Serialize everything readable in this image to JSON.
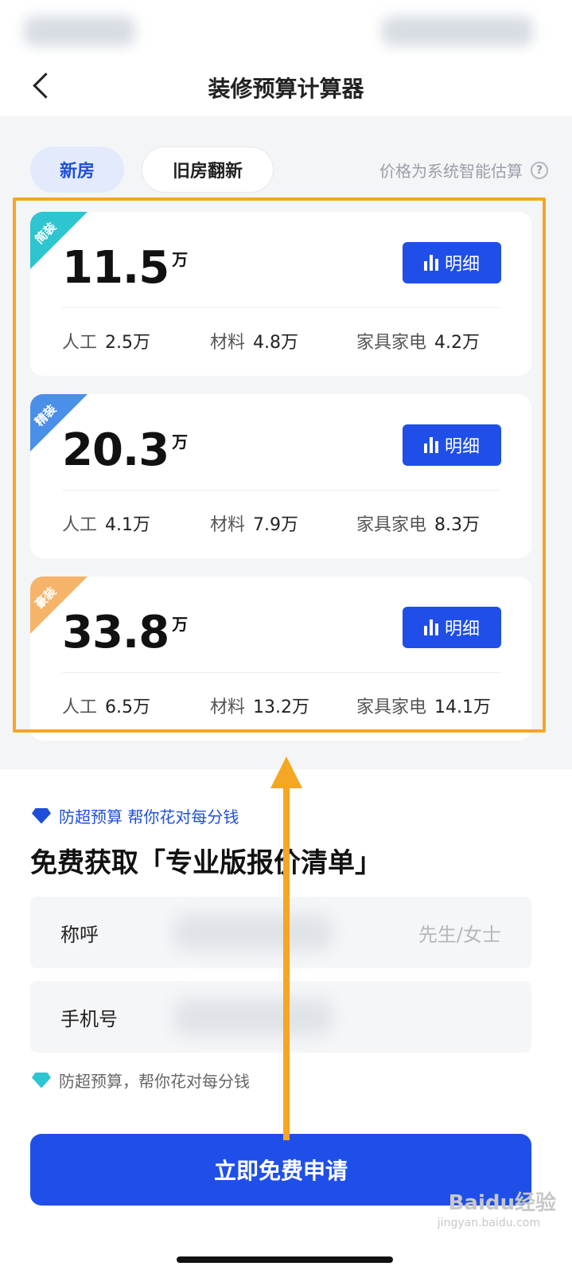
{
  "nav": {
    "title": "装修预算计算器"
  },
  "tabs": [
    {
      "label": "新房"
    },
    {
      "label": "旧房翻新"
    }
  ],
  "price_note": "价格为系统智能估算",
  "help_icon": "question-circle-icon",
  "cards": [
    {
      "tag": "简装",
      "tag_color": "#2cc5d0",
      "total": "11.5",
      "unit": "万",
      "detail_label": "明细",
      "labor_label": "人工",
      "labor": "2.5万",
      "material_label": "材料",
      "material": "4.8万",
      "furniture_label": "家具家电",
      "furniture": "4.2万"
    },
    {
      "tag": "精装",
      "tag_color": "#4a8fe8",
      "total": "20.3",
      "unit": "万",
      "detail_label": "明细",
      "labor_label": "人工",
      "labor": "4.1万",
      "material_label": "材料",
      "material": "7.9万",
      "furniture_label": "家具家电",
      "furniture": "8.3万"
    },
    {
      "tag": "豪装",
      "tag_color": "#f5b46a",
      "total": "33.8",
      "unit": "万",
      "detail_label": "明细",
      "labor_label": "人工",
      "labor": "6.5万",
      "material_label": "材料",
      "material": "13.2万",
      "furniture_label": "家具家电",
      "furniture": "14.1万"
    }
  ],
  "form": {
    "promo_top": "防超预算 帮你花对每分钱",
    "heading": "免费获取「专业版报价清单」",
    "name_label": "称呼",
    "name_placeholder": "先生/女士",
    "phone_label": "手机号",
    "promo_bottom": "防超预算，帮你花对每分钱",
    "submit_label": "立即免费申请"
  },
  "watermark": {
    "brand": "Baidu经验",
    "url": "jingyan.baidu.com"
  },
  "colors": {
    "accent": "#1f4fe8",
    "highlight": "#f5a623"
  }
}
